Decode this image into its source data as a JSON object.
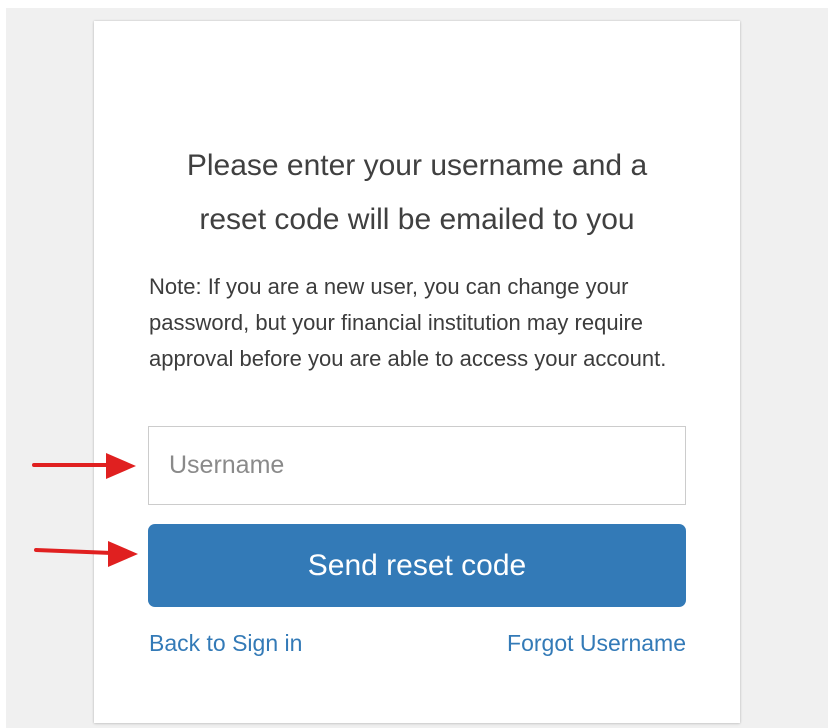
{
  "card": {
    "heading_line1": "Please enter your username and a",
    "heading_line2": "reset code will be emailed to you",
    "note": "Note: If you are a new user, you can change your password, but your financial institution may require approval before you are able to access your account."
  },
  "form": {
    "username_placeholder": "Username",
    "username_value": "",
    "submit_label": "Send reset code"
  },
  "links": {
    "back_to_sign_in": "Back to Sign in",
    "forgot_username": "Forgot Username"
  },
  "annotations": {
    "arrow_color": "#e02020"
  },
  "colors": {
    "primary": "#337ab7",
    "page_background": "#f0f0f0",
    "text": "#404040"
  }
}
